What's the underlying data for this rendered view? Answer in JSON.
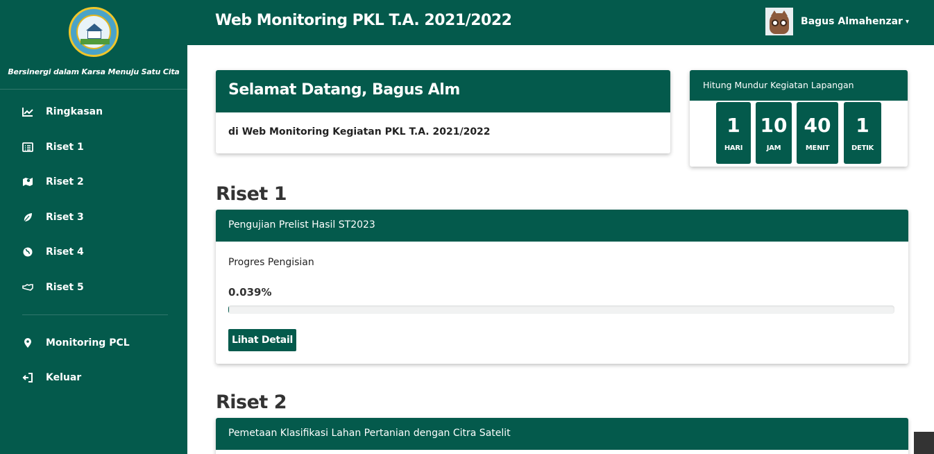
{
  "sidebar": {
    "tagline": "Bersinergi dalam Karsa Menuju Satu Cita",
    "items": [
      {
        "label": "Ringkasan",
        "icon": "chart-line-icon"
      },
      {
        "label": "Riset 1",
        "icon": "list-alt-icon"
      },
      {
        "label": "Riset 2",
        "icon": "map-icon"
      },
      {
        "label": "Riset 3",
        "icon": "leaf-icon"
      },
      {
        "label": "Riset 4",
        "icon": "globe-icon"
      },
      {
        "label": "Riset 5",
        "icon": "handshake-icon"
      },
      {
        "label": "Monitoring PCL",
        "icon": "map-marker-icon"
      },
      {
        "label": "Keluar",
        "icon": "sign-out-icon"
      }
    ]
  },
  "header": {
    "title": "Web Monitoring PKL T.A. 2021/2022",
    "user_name": "Bagus Almahenzar"
  },
  "welcome": {
    "title": "Selamat Datang, Bagus Alm",
    "subtitle": "di Web Monitoring Kegiatan PKL T.A. 2021/2022"
  },
  "countdown": {
    "title": "Hitung Mundur Kegiatan Lapangan",
    "units": [
      {
        "value": "1",
        "label": "HARI"
      },
      {
        "value": "10",
        "label": "JAM"
      },
      {
        "value": "40",
        "label": "MENIT"
      },
      {
        "value": "1",
        "label": "DETIK"
      }
    ]
  },
  "riset1": {
    "section_title": "Riset 1",
    "card_title": "Pengujian Prelist Hasil ST2023",
    "progress_label": "Progres Pengisian",
    "progress_text": "0.039%",
    "progress_percent": 0.039,
    "button_label": "Lihat Detail"
  },
  "riset2": {
    "section_title": "Riset 2",
    "card_title": "Pemetaan Klasifikasi Lahan Pertanian dengan Citra Satelit"
  },
  "colors": {
    "primary": "#045a4c",
    "text_dark": "#333333"
  }
}
